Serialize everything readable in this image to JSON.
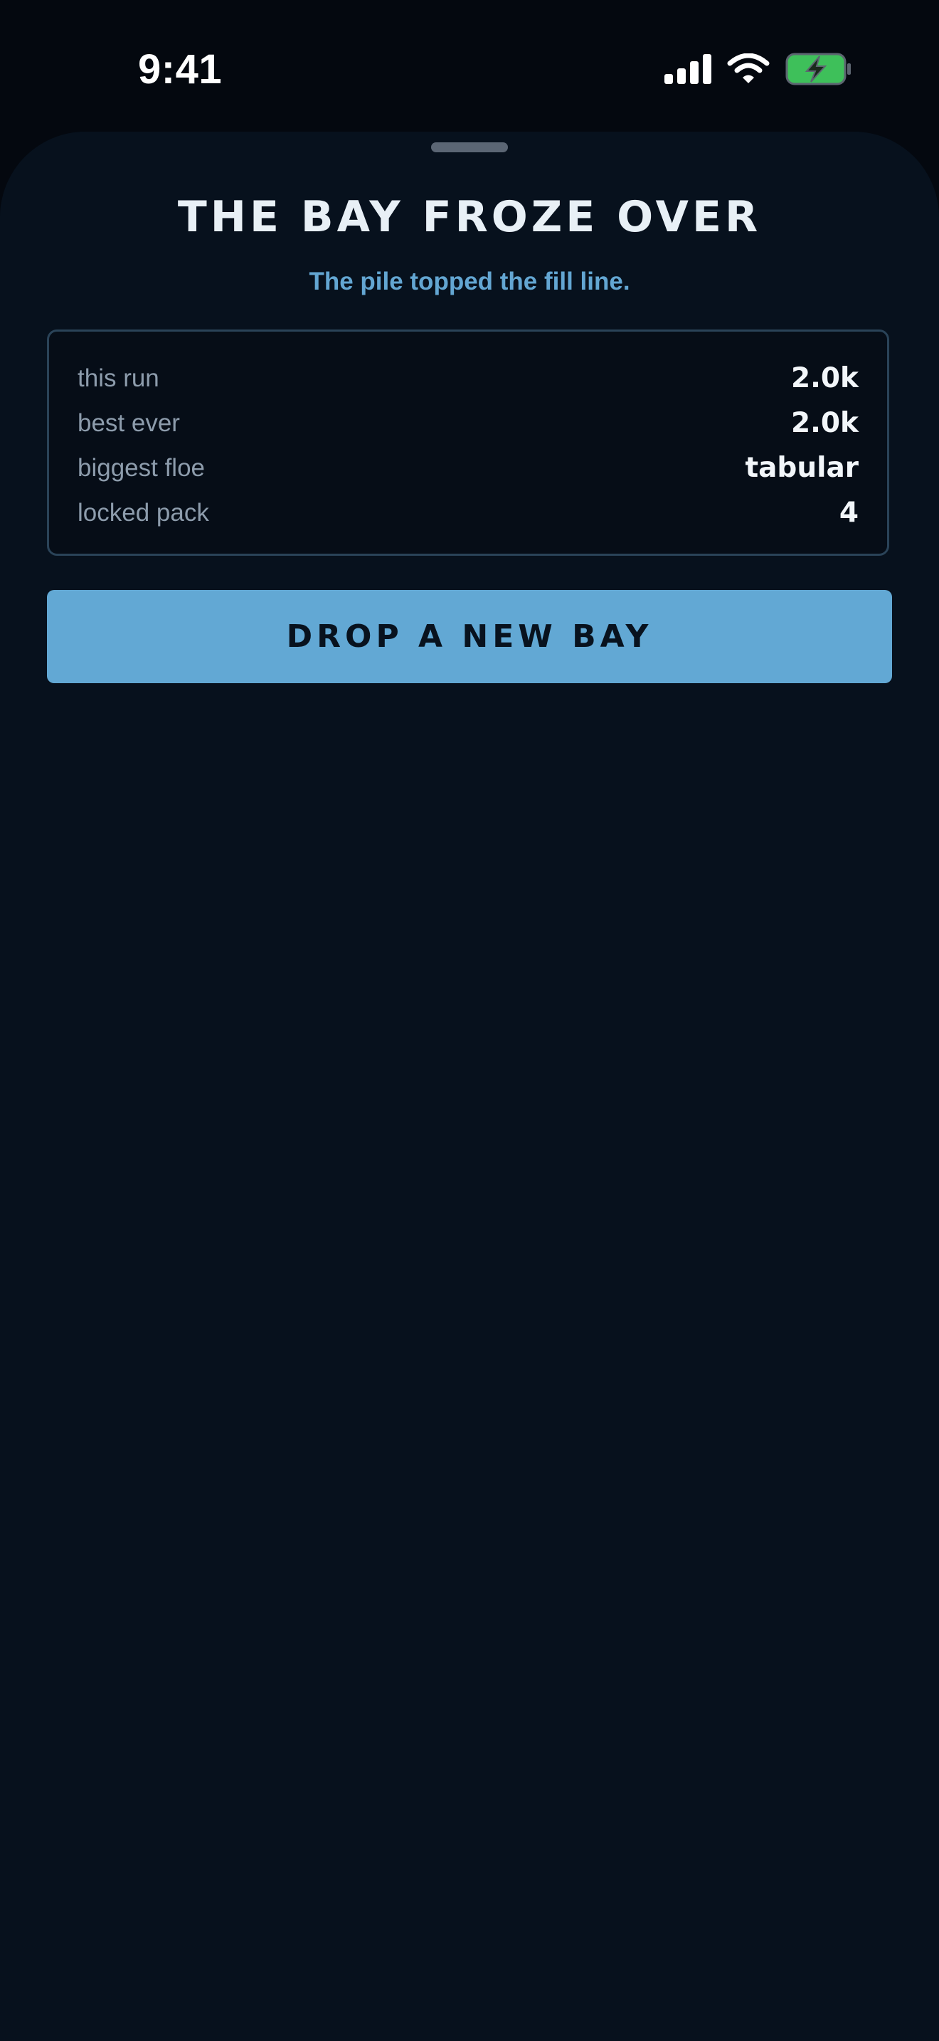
{
  "status_bar": {
    "time": "9:41",
    "icons": [
      "cellular-signal-icon",
      "wifi-icon",
      "battery-charging-icon"
    ],
    "battery_color": "#3ec05a"
  },
  "sheet": {
    "title": "THE BAY FROZE OVER",
    "subtitle": "The pile topped the fill line.",
    "stats": [
      {
        "label": "this run",
        "value": "2.0k"
      },
      {
        "label": "best ever",
        "value": "2.0k"
      },
      {
        "label": "biggest floe",
        "value": "tabular"
      },
      {
        "label": "locked pack",
        "value": "4"
      }
    ],
    "primary_button_label": "DROP A NEW BAY"
  },
  "colors": {
    "background": "#04080f",
    "sheet": "#07111d",
    "accent": "#62a8d4",
    "card_border": "#2a4358"
  }
}
